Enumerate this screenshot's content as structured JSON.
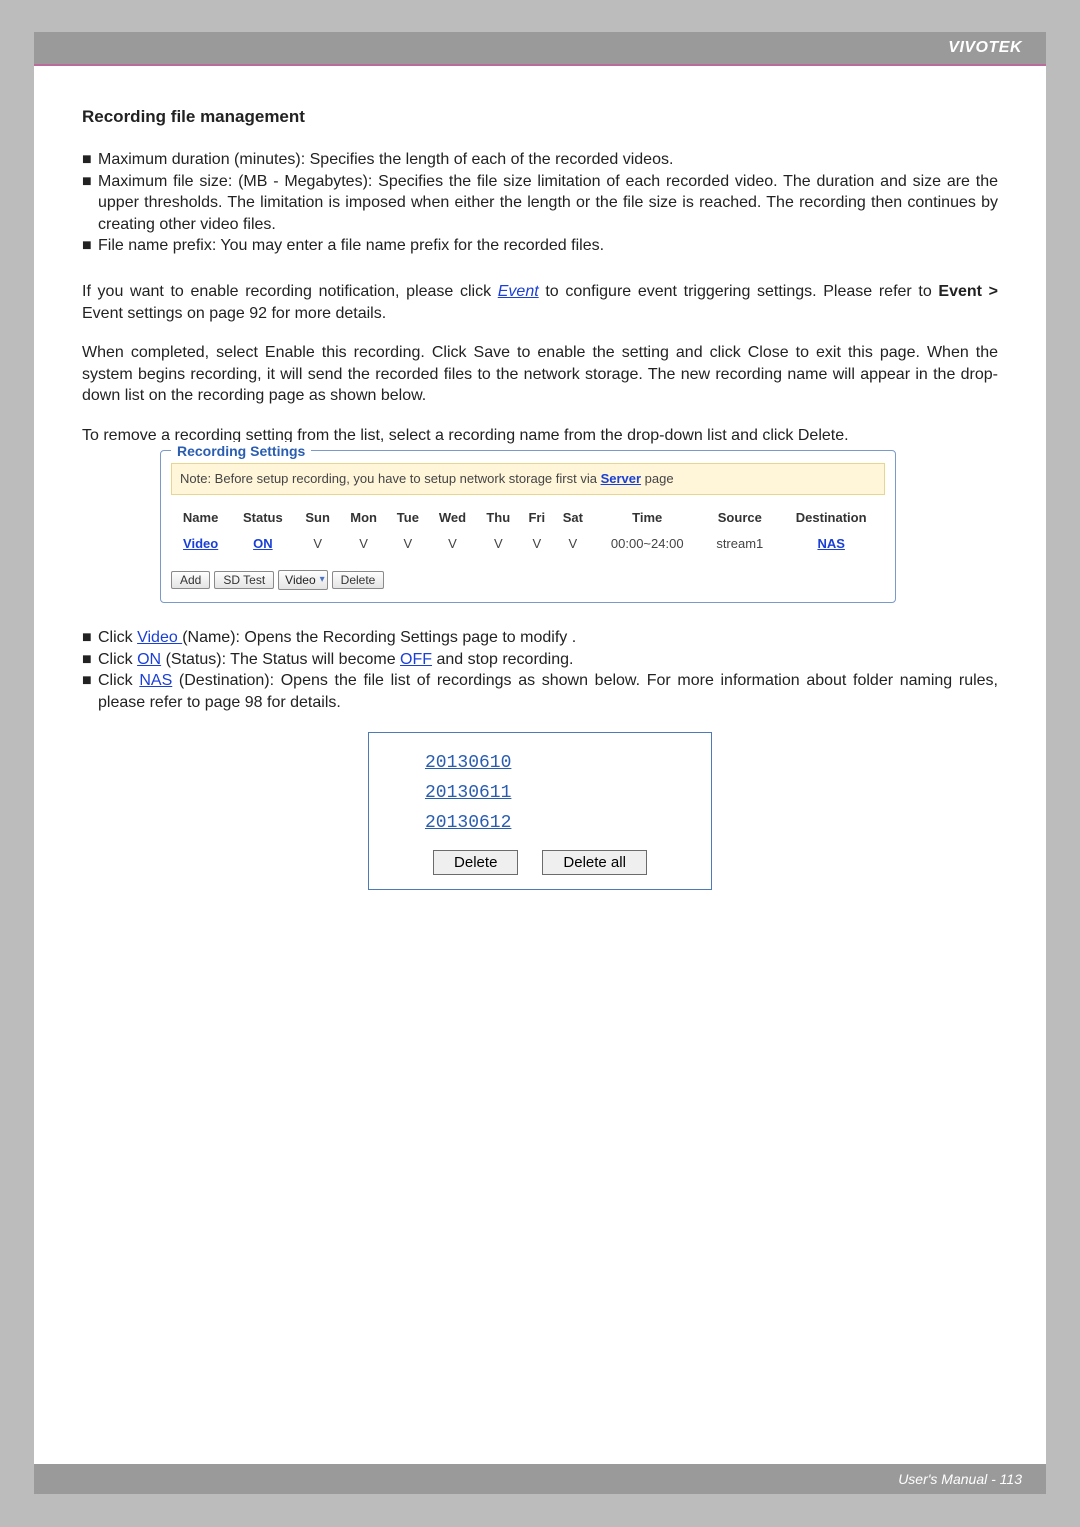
{
  "brand": "VIVOTEK",
  "footer": "User's Manual - 113",
  "section_title": "Recording file management",
  "bullets": {
    "b1": "Maximum duration (minutes): Specifies the length of each of the recorded videos.",
    "b2": "Maximum file size: (MB - Megabytes): Specifies the file size limitation of each recorded video. The duration and size are the upper thresholds. The limitation is imposed when either the length or the file size is reached. The recording then continues by creating other video files.",
    "b3": "File name prefix: You may enter a file name prefix for the recorded files."
  },
  "para_event_pre": "If you want to enable recording notification, please click ",
  "event_link": "Event",
  "para_event_post": " to configure event triggering settings. Please refer to ",
  "event_bold": "Event >",
  "para_event_tail": " Event settings on page 92 for more details.",
  "para_completed": "When completed, select Enable this recording. Click Save to enable the setting and click Close to exit this page. When the system begins recording, it will send the recorded files to the network storage. The new recording name will appear in the drop-down list on the recording page as shown below.",
  "para_remove": "To remove a recording setting from the list, select a recording name from the drop-down list and click Delete.",
  "rs": {
    "legend": "Recording Settings",
    "note_pre": "Note: Before setup recording, you have to setup network storage first via ",
    "note_link": "Server",
    "note_post": " page",
    "headers": {
      "name": "Name",
      "status": "Status",
      "sun": "Sun",
      "mon": "Mon",
      "tue": "Tue",
      "wed": "Wed",
      "thu": "Thu",
      "fri": "Fri",
      "sat": "Sat",
      "time": "Time",
      "source": "Source",
      "dest": "Destination"
    },
    "row": {
      "name": "Video",
      "status": "ON",
      "sun": "V",
      "mon": "V",
      "tue": "V",
      "wed": "V",
      "thu": "V",
      "fri": "V",
      "sat": "V",
      "time": "00:00~24:00",
      "source": "stream1",
      "dest": "NAS"
    },
    "btn_add": "Add",
    "btn_sdtest": "SD Test",
    "sel_value": "Video",
    "btn_delete": "Delete"
  },
  "clicks": {
    "c1_pre": "Click ",
    "c1_link": "Video ",
    "c1_post": "(Name): Opens the Recording Settings page to modify .",
    "c2_pre": "Click ",
    "c2_link": "ON",
    "c2_mid": " (Status): The Status will become  ",
    "c2_link2": "OFF",
    "c2_post": " and stop recording.",
    "c3_pre": "Click ",
    "c3_link": "NAS",
    "c3_post": " (Destination): Opens the file list of recordings as shown below. For more information about folder naming rules, please refer to page 98 for details."
  },
  "filelist": {
    "f1": "20130610",
    "f2": "20130611",
    "f3": "20130612",
    "delete": "Delete",
    "delete_all": "Delete all"
  }
}
